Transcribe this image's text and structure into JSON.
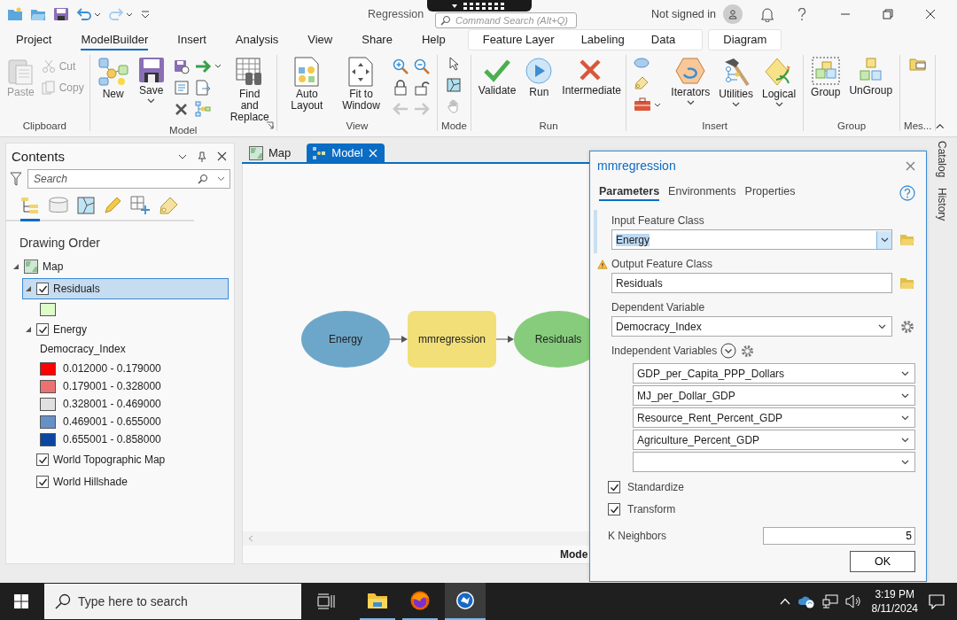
{
  "app": {
    "title": "Regression",
    "search_placeholder": "Command Search (Alt+Q)",
    "account": "Not signed in"
  },
  "ribbon_tabs": [
    {
      "label": "Project",
      "selected": false
    },
    {
      "label": "ModelBuilder",
      "selected": true
    },
    {
      "label": "Insert",
      "selected": false
    },
    {
      "label": "Analysis",
      "selected": false
    },
    {
      "label": "View",
      "selected": false
    },
    {
      "label": "Share",
      "selected": false
    },
    {
      "label": "Help",
      "selected": false
    }
  ],
  "contextual_tabs": [
    {
      "tabs": [
        {
          "label": "Feature Layer",
          "selected": false
        },
        {
          "label": "Labeling",
          "selected": false
        },
        {
          "label": "Data",
          "selected": false
        }
      ]
    },
    {
      "tabs": [
        {
          "label": "Diagram",
          "selected": false
        }
      ]
    }
  ],
  "ribbon_groups": [
    {
      "title": "Clipboard",
      "items": [
        {
          "kind": "large",
          "label": "Paste",
          "disabled": true,
          "menu": false
        },
        {
          "kind": "small_stack",
          "buttons": [
            {
              "label": "Cut",
              "disabled": true
            },
            {
              "label": "Copy",
              "disabled": true
            }
          ]
        }
      ]
    },
    {
      "title": "Model",
      "items": [
        {
          "kind": "large",
          "label": "New",
          "disabled": false,
          "menu": false
        },
        {
          "kind": "large",
          "label": "Save",
          "disabled": false,
          "menu": true
        },
        {
          "kind": "tools"
        },
        {
          "kind": "large",
          "label": "Find and Replace",
          "disabled": false,
          "menu": false
        }
      ]
    },
    {
      "title": "View",
      "items": [
        {
          "kind": "large",
          "label": "Auto Layout",
          "disabled": false,
          "menu": false
        },
        {
          "kind": "large",
          "label": "Fit to Window",
          "disabled": false,
          "menu": false
        },
        {
          "kind": "tools"
        }
      ]
    },
    {
      "title": "Mode",
      "items": [
        {
          "kind": "tools"
        }
      ]
    },
    {
      "title": "Run",
      "items": [
        {
          "kind": "large",
          "label": "Validate",
          "disabled": false,
          "menu": false
        },
        {
          "kind": "large",
          "label": "Run",
          "disabled": false,
          "menu": false
        },
        {
          "kind": "large",
          "label": "Intermediate",
          "disabled": false,
          "menu": false
        }
      ]
    },
    {
      "title": "Insert",
      "items": [
        {
          "kind": "tools"
        },
        {
          "kind": "large",
          "label": "Iterators",
          "disabled": false,
          "menu": true
        },
        {
          "kind": "large",
          "label": "Utilities",
          "disabled": false,
          "menu": true
        },
        {
          "kind": "large",
          "label": "Logical",
          "disabled": false,
          "menu": true
        }
      ]
    },
    {
      "title": "Group",
      "items": [
        {
          "kind": "large",
          "label": "Group",
          "disabled": false,
          "menu": false
        },
        {
          "kind": "large",
          "label": "UnGroup",
          "disabled": false,
          "menu": false
        }
      ]
    },
    {
      "title": "Mes...",
      "items": [
        {
          "kind": "tools"
        }
      ]
    }
  ],
  "contents": {
    "title": "Contents",
    "search_placeholder": "Search",
    "heading": "Drawing Order",
    "tree": [
      {
        "label": "Map",
        "kind": "map",
        "expanded": true,
        "children": [
          {
            "label": "Residuals",
            "kind": "layer",
            "checked": true,
            "selected": true,
            "expanded": true,
            "legend": {
              "classes": [
                {
                  "color": "#ddfcc8"
                }
              ]
            }
          },
          {
            "label": "Energy",
            "kind": "layer",
            "checked": true,
            "selected": false,
            "expanded": true,
            "legend": {
              "field": "Democracy_Index",
              "classes": [
                {
                  "color": "#ff0000",
                  "label": "0.012000 - 0.179000"
                },
                {
                  "color": "#ec7272",
                  "label": "0.179001 - 0.328000"
                },
                {
                  "color": "#e0e0e0",
                  "label": "0.328001 - 0.469000"
                },
                {
                  "color": "#6690c8",
                  "label": "0.469001 - 0.655000"
                },
                {
                  "color": "#0b47a1",
                  "label": "0.655001 - 0.858000"
                }
              ]
            }
          },
          {
            "label": "World Topographic Map",
            "kind": "layer",
            "checked": true,
            "selected": false
          },
          {
            "label": "World Hillshade",
            "kind": "layer",
            "checked": true,
            "selected": false
          }
        ]
      }
    ]
  },
  "views": {
    "tabs": [
      {
        "label": "Map",
        "kind": "map",
        "selected": false,
        "closable": false
      },
      {
        "label": "Model",
        "kind": "model",
        "selected": true,
        "closable": true
      }
    ],
    "nodes": [
      {
        "label": "Energy",
        "kind": "data",
        "color": "#6ca7c9"
      },
      {
        "label": "mmregression",
        "kind": "tool",
        "color": "#f2df77"
      },
      {
        "label": "Residuals",
        "kind": "data",
        "color": "#86cc7c"
      }
    ],
    "status": "Mode"
  },
  "dialog": {
    "title": "mmregression",
    "tabs": [
      {
        "label": "Parameters",
        "selected": true
      },
      {
        "label": "Environments",
        "selected": false
      },
      {
        "label": "Properties",
        "selected": false
      }
    ],
    "parameters": [
      {
        "kind": "dataset",
        "label": "Input Feature Class",
        "value": "Energy",
        "dropdown": true,
        "focused": true,
        "warning": false
      },
      {
        "kind": "dataset",
        "label": "Output Feature Class",
        "value": "Residuals",
        "dropdown": false,
        "focused": false,
        "warning": true
      },
      {
        "kind": "field",
        "label": "Dependent Variable",
        "value": "Democracy_Index",
        "warning": false
      },
      {
        "kind": "field_list",
        "label": "Independent Variables",
        "values": [
          "GDP_per_Capita_PPP_Dollars",
          "MJ_per_Dollar_GDP",
          "Resource_Rent_Percent_GDP",
          "Agriculture_Percent_GDP"
        ],
        "warning": false
      },
      {
        "kind": "check",
        "label": "Standardize",
        "checked": true
      },
      {
        "kind": "check",
        "label": "Transform",
        "checked": true
      },
      {
        "kind": "number",
        "label": "K Neighbors",
        "value": "5"
      }
    ],
    "button": "OK"
  },
  "side_tabs": [
    "Catalog",
    "History"
  ],
  "taskbar": {
    "search_placeholder": "Type here to search",
    "apps": [
      {
        "kind": "explorer",
        "active": false
      },
      {
        "kind": "firefox",
        "active": false
      },
      {
        "kind": "arcgis",
        "active": true
      }
    ],
    "time": "3:19 PM",
    "date": "8/11/2024"
  }
}
